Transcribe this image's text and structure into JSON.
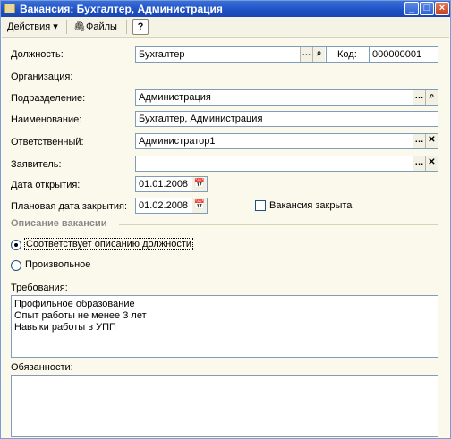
{
  "window": {
    "title": "Вакансия: Бухгалтер, Администрация"
  },
  "toolbar": {
    "actions_label": "Действия ▾",
    "files_label": "Файлы",
    "help_label": "?"
  },
  "form": {
    "position_label": "Должность:",
    "position_value": "Бухгалтер",
    "code_label": "Код:",
    "code_value": "000000001",
    "organization_label": "Организация:",
    "department_label": "Подразделение:",
    "department_value": "Администрация",
    "name_label": "Наименование:",
    "name_value": "Бухгалтер, Администрация",
    "responsible_label": "Ответственный:",
    "responsible_value": "Администратор1",
    "applicant_label": "Заявитель:",
    "applicant_value": "",
    "open_date_label": "Дата открытия:",
    "open_date_value": "01.01.2008",
    "close_date_label": "Плановая дата закрытия:",
    "close_date_value": "01.02.2008",
    "closed_label": "Вакансия закрыта",
    "closed_checked": false
  },
  "description": {
    "section_title": "Описание вакансии",
    "option_match_label": "Соответствует описанию должности",
    "option_custom_label": "Произвольное",
    "selected": "match"
  },
  "requirements": {
    "label": "Требования:",
    "lines": [
      "Профильное образование",
      "Опыт работы не менее 3 лет",
      "Навыки работы в УПП"
    ]
  },
  "duties": {
    "label": "Обязанности:",
    "text": ""
  },
  "icons": {
    "ellipsis": "ellipsis-icon",
    "search": "search-icon",
    "clear": "clear-icon",
    "calendar": "calendar-icon"
  }
}
